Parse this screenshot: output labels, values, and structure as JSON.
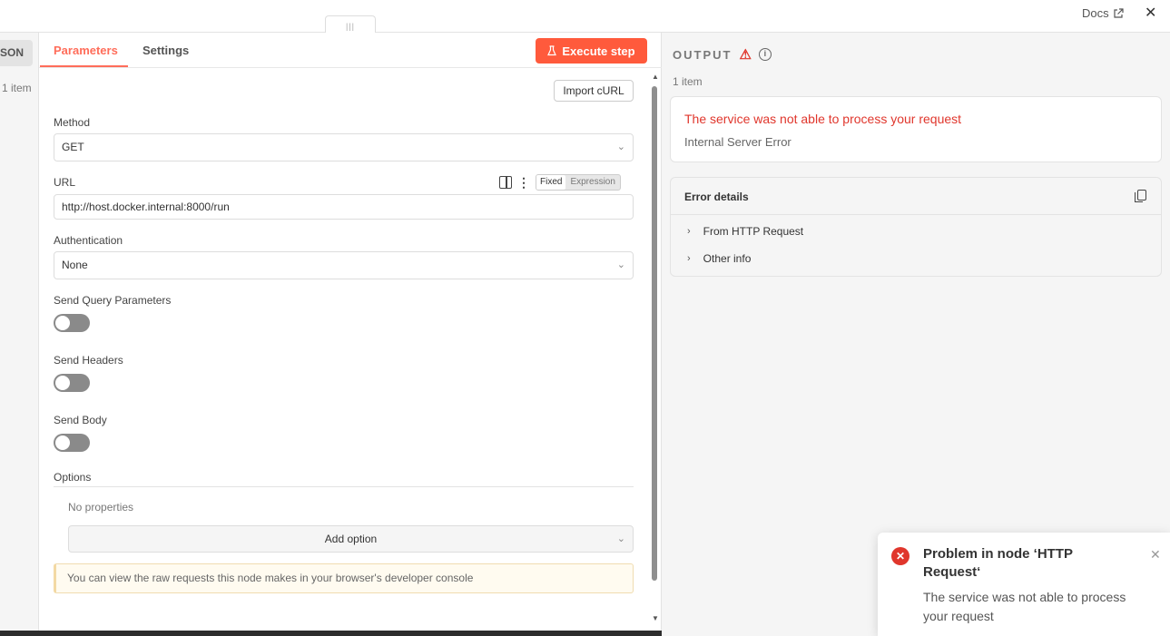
{
  "topbar": {
    "handle_glyph": "|||",
    "docs_label": "Docs",
    "external_icon": "external-link-icon",
    "close_glyph": "✕"
  },
  "input_panel": {
    "json_tab_label": "SON",
    "item_count": "1 item"
  },
  "params": {
    "tabs": [
      {
        "label": "Parameters",
        "active": true
      },
      {
        "label": "Settings",
        "active": false
      }
    ],
    "execute_label": "Execute step",
    "execute_icon": "flask-icon",
    "import_curl_label": "Import cURL",
    "method": {
      "label": "Method",
      "value": "GET"
    },
    "url": {
      "label": "URL",
      "value": "http://host.docker.internal:8000/run",
      "mode_fixed": "Fixed",
      "mode_expression": "Expression"
    },
    "authentication": {
      "label": "Authentication",
      "value": "None"
    },
    "send_query": {
      "label": "Send Query Parameters",
      "enabled": false
    },
    "send_headers": {
      "label": "Send Headers",
      "enabled": false
    },
    "send_body": {
      "label": "Send Body",
      "enabled": false
    },
    "options": {
      "label": "Options",
      "empty_text": "No properties",
      "add_label": "Add option"
    },
    "notice": "You can view the raw requests this node makes in your browser's developer console"
  },
  "output": {
    "title": "OUTPUT",
    "item_count": "1 item",
    "error_title": "The service was not able to process your request",
    "error_subtitle": "Internal Server Error",
    "details_title": "Error details",
    "details_rows": [
      "From HTTP Request",
      "Other info"
    ]
  },
  "toast": {
    "title": "Problem in node ‘HTTP Request‘",
    "message": "The service was not able to process your request"
  },
  "colors": {
    "accent": "#ff6d5a",
    "execute_bg": "#ff5a3c",
    "error": "#e0362c"
  }
}
